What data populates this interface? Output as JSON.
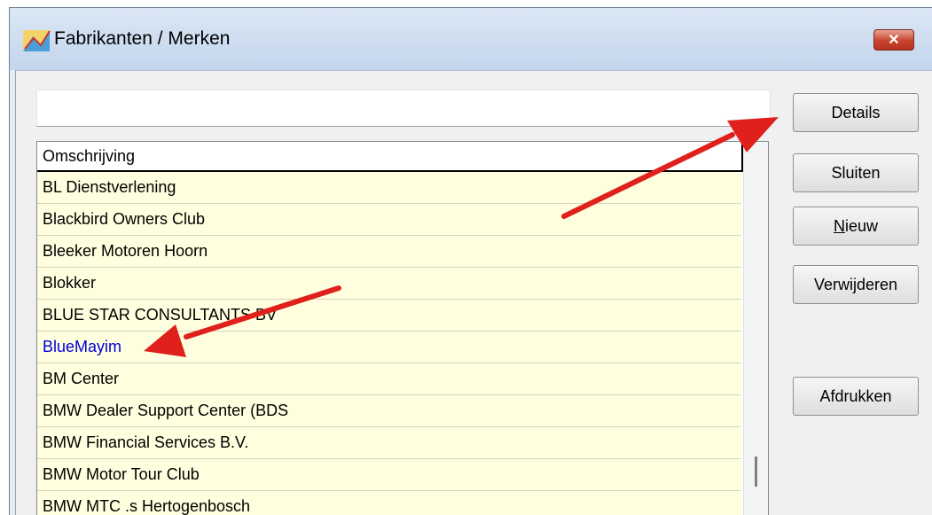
{
  "window": {
    "title": "Fabrikanten / Merken",
    "close_label": "✕"
  },
  "filter": {
    "value": ""
  },
  "grid": {
    "header": "Omschrijving",
    "rows": [
      "BL Dienstverlening",
      "Blackbird Owners Club",
      "Bleeker Motoren Hoorn",
      "Blokker",
      "BLUE STAR CONSULTANTS BV",
      "BlueMayim",
      "BM Center",
      "BMW Dealer Support Center (BDS",
      "BMW Financial Services B.V.",
      "BMW Motor Tour Club",
      "BMW MTC .s Hertogenbosch"
    ],
    "highlighted_row": "BlueMayim",
    "row_bg_color": "#ffffe0",
    "highlight_color": "#0000dd"
  },
  "buttons": {
    "details": "Details",
    "sluiten": "Sluiten",
    "nieuw_first": "N",
    "nieuw_rest": "ieuw",
    "verwijderen": "Verwijderen",
    "afdrukken": "Afdrukken"
  },
  "annotation": {
    "arrow_color": "#e0201b"
  }
}
